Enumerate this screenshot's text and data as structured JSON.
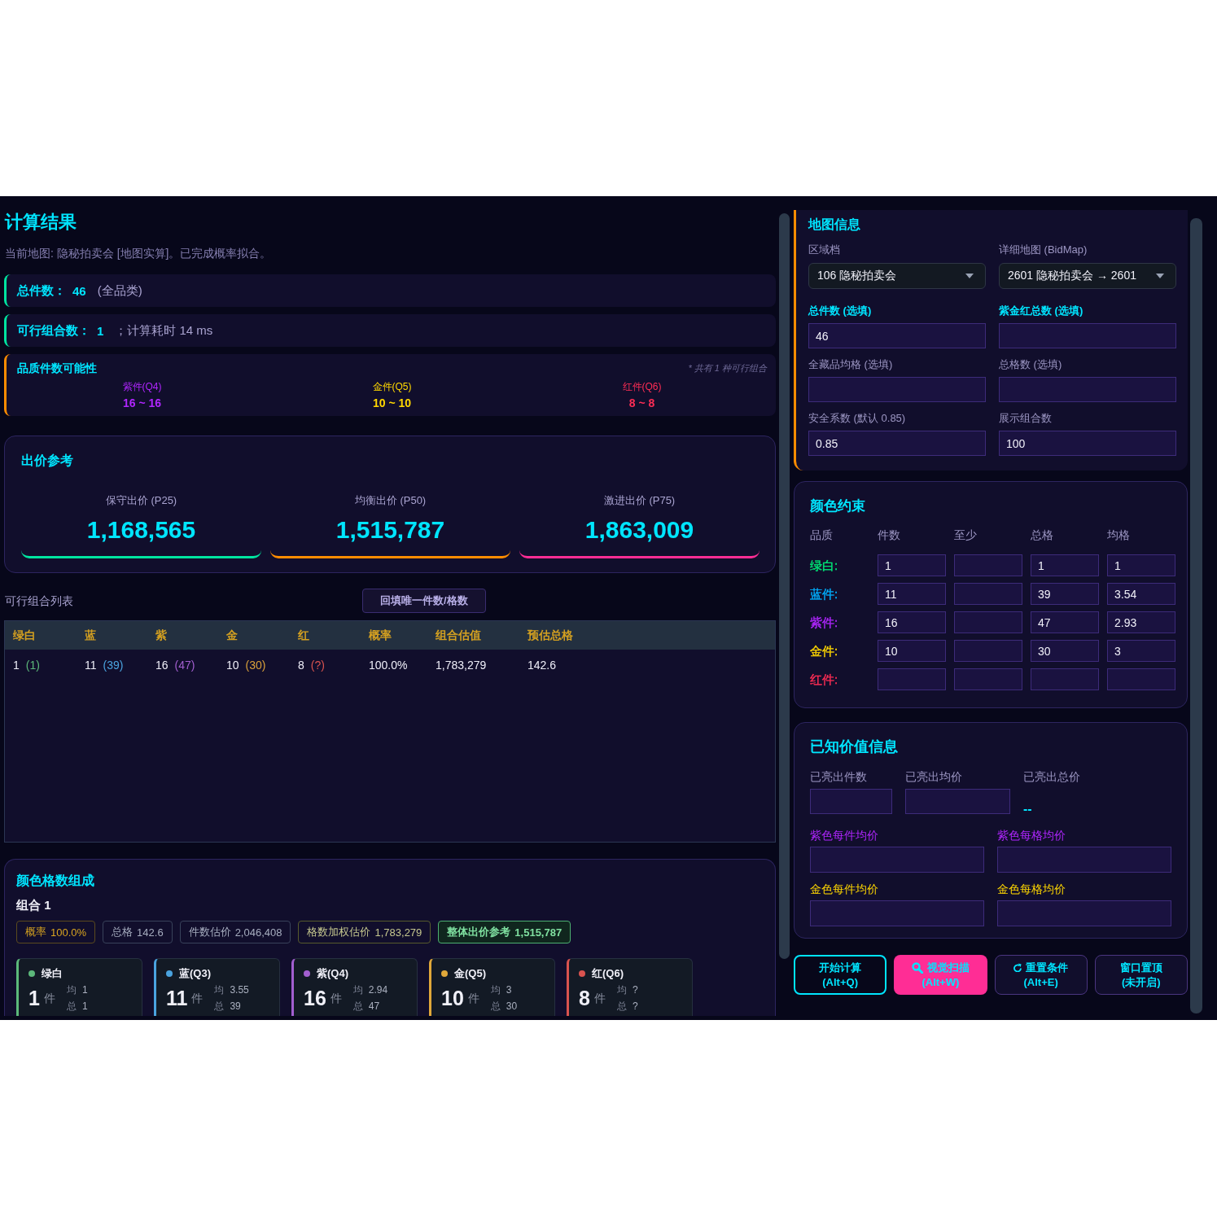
{
  "results": {
    "title": "计算结果",
    "subtitle": "当前地图: 隐秘拍卖会 [地图实算]。已完成概率拟合。",
    "summary": [
      {
        "label": "总件数：",
        "value": "46",
        "note": "(全品类)"
      },
      {
        "label": "可行组合数：",
        "value": "1",
        "note": "；计算耗时 14 ms"
      }
    ],
    "possibility": {
      "title": "品质件数可能性",
      "note": "* 共有 1 种可行组合",
      "items": [
        {
          "label": "紫件(Q4)",
          "range": "16 ~ 16",
          "color": "#b026ff"
        },
        {
          "label": "金件(Q5)",
          "range": "10 ~ 10",
          "color": "#ffd700"
        },
        {
          "label": "红件(Q6)",
          "range": "8 ~ 8",
          "color": "#ff2d55"
        }
      ]
    }
  },
  "bid": {
    "title": "出价参考",
    "items": [
      {
        "label": "保守出价 (P25)",
        "value": "1,168,565",
        "color": "#00e5a0"
      },
      {
        "label": "均衡出价 (P50)",
        "value": "1,515,787",
        "color": "#ff8c00"
      },
      {
        "label": "激进出价 (P75)",
        "value": "1,863,009",
        "color": "#ff2d95"
      }
    ]
  },
  "combos": {
    "title": "可行组合列表",
    "fill_button": "回填唯一件数/格数",
    "columns": [
      "绿白",
      "蓝",
      "紫",
      "金",
      "红",
      "概率",
      "组合估值",
      "预估总格"
    ],
    "rows": [
      {
        "cells": [
          {
            "value": "1",
            "note": "(1)",
            "color": "#5cb87a"
          },
          {
            "value": "11",
            "note": "(39)",
            "color": "#4aa3df"
          },
          {
            "value": "16",
            "note": "(47)",
            "color": "#a35fd0"
          },
          {
            "value": "10",
            "note": "(30)",
            "color": "#d9a03a"
          },
          {
            "value": "8",
            "note": "(?)",
            "color": "#d9534f"
          },
          {
            "value": "100.0%"
          },
          {
            "value": "1,783,279"
          },
          {
            "value": "142.6"
          }
        ]
      }
    ]
  },
  "composition": {
    "title": "颜色格数组成",
    "combo_title": "组合 1",
    "chips": [
      {
        "label": "概率",
        "value": "100.0%",
        "kind": "probability"
      },
      {
        "label": "总格",
        "value": "142.6",
        "kind": "neutral"
      },
      {
        "label": "件数估价",
        "value": "2,046,408",
        "kind": "neutral"
      },
      {
        "label": "格数加权估价",
        "value": "1,783,279",
        "kind": "weighted"
      },
      {
        "label": "整体出价参考",
        "value": "1,515,787",
        "kind": "overall"
      }
    ],
    "qualities": [
      {
        "name": "绿白",
        "count": "1",
        "unit": "件",
        "avg_label": "均",
        "avg": "1",
        "total_label": "总",
        "total": "1",
        "color": "#5cb87a"
      },
      {
        "name": "蓝(Q3)",
        "count": "11",
        "unit": "件",
        "avg_label": "均",
        "avg": "3.55",
        "total_label": "总",
        "total": "39",
        "color": "#4aa3df"
      },
      {
        "name": "紫(Q4)",
        "count": "16",
        "unit": "件",
        "avg_label": "均",
        "avg": "2.94",
        "total_label": "总",
        "total": "47",
        "color": "#a35fd0"
      },
      {
        "name": "金(Q5)",
        "count": "10",
        "unit": "件",
        "avg_label": "均",
        "avg": "3",
        "total_label": "总",
        "total": "30",
        "color": "#e0a83a"
      },
      {
        "name": "红(Q6)",
        "count": "8",
        "unit": "件",
        "avg_label": "均",
        "avg": "?",
        "total_label": "总",
        "total": "?",
        "color": "#d9534f"
      }
    ]
  },
  "map_info": {
    "title": "地图信息",
    "fields": [
      {
        "label": "区域档",
        "kind": "select",
        "value": "106 隐秘拍卖会",
        "emphasized": false
      },
      {
        "label": "详细地图 (BidMap)",
        "kind": "select",
        "value": "2601 隐秘拍卖会 → 2601",
        "emphasized": false
      },
      {
        "label": "总件数 (选填)",
        "kind": "input",
        "value": "46",
        "emphasized": true
      },
      {
        "label": "紫金红总数 (选填)",
        "kind": "input",
        "emphasized": true
      },
      {
        "label": "全藏品均格 (选填)",
        "kind": "input",
        "emphasized": false
      },
      {
        "label": "总格数 (选填)",
        "kind": "input",
        "emphasized": false
      },
      {
        "label": "安全系数 (默认 0.85)",
        "kind": "input",
        "value": "0.85",
        "emphasized": false
      },
      {
        "label": "展示组合数",
        "kind": "input",
        "value": "100",
        "emphasized": false
      }
    ]
  },
  "color_constraints": {
    "title": "颜色约束",
    "columns": [
      "品质",
      "件数",
      "至少",
      "总格",
      "均格"
    ],
    "rows": [
      {
        "color": "#00e676",
        "cells": [
          {
            "kind": "label",
            "value": "绿白:"
          },
          {
            "kind": "input",
            "value": "1"
          },
          {
            "kind": "input"
          },
          {
            "kind": "input",
            "value": "1"
          },
          {
            "kind": "input",
            "value": "1"
          }
        ]
      },
      {
        "color": "#00b0ff",
        "cells": [
          {
            "kind": "label",
            "value": "蓝件:"
          },
          {
            "kind": "input",
            "value": "11"
          },
          {
            "kind": "input"
          },
          {
            "kind": "input",
            "value": "39"
          },
          {
            "kind": "input",
            "value": "3.54"
          }
        ]
      },
      {
        "color": "#b026ff",
        "cells": [
          {
            "kind": "label",
            "value": "紫件:"
          },
          {
            "kind": "input",
            "value": "16"
          },
          {
            "kind": "input"
          },
          {
            "kind": "input",
            "value": "47"
          },
          {
            "kind": "input",
            "value": "2.93"
          }
        ]
      },
      {
        "color": "#ffd700",
        "cells": [
          {
            "kind": "label",
            "value": "金件:"
          },
          {
            "kind": "input",
            "value": "10"
          },
          {
            "kind": "input"
          },
          {
            "kind": "input",
            "value": "30"
          },
          {
            "kind": "input",
            "value": "3"
          }
        ]
      },
      {
        "color": "#ff2d55",
        "cells": [
          {
            "kind": "label",
            "value": "红件:"
          },
          {
            "kind": "input"
          },
          {
            "kind": "input"
          },
          {
            "kind": "input"
          },
          {
            "kind": "input"
          }
        ]
      }
    ]
  },
  "known_values": {
    "title": "已知价值信息",
    "first_row": [
      {
        "label": "已亮出件数",
        "kind": "input"
      },
      {
        "label": "已亮出均价",
        "kind": "input"
      },
      {
        "label": "已亮出总价",
        "kind": "readout",
        "value": "--"
      }
    ],
    "price_fields": [
      {
        "label": "紫色每件均价",
        "color": "#b026ff"
      },
      {
        "label": "紫色每格均价",
        "color": "#b026ff"
      },
      {
        "label": "金色每件均价",
        "color": "#ffd700"
      },
      {
        "label": "金色每格均价",
        "color": "#ffd700"
      }
    ]
  },
  "actions": [
    {
      "label": "开始计算",
      "hotkey": "(Alt+Q)",
      "kind": "primary"
    },
    {
      "label": "视觉扫描",
      "hotkey": "(Alt+W)",
      "kind": "scan"
    },
    {
      "label": "重置条件",
      "hotkey": "(Alt+E)",
      "kind": "reset"
    },
    {
      "label": "窗口置顶",
      "hotkey": "(未开启)",
      "kind": "pin"
    }
  ]
}
